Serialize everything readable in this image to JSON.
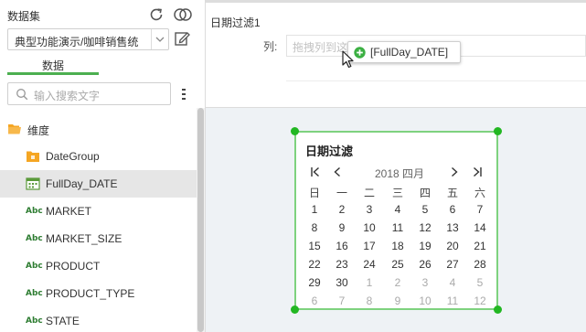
{
  "dataset": {
    "title": "数据集",
    "selected": "典型功能演示/咖啡销售统",
    "tab_label": "数据"
  },
  "search": {
    "placeholder": "输入搜索文字"
  },
  "tree": {
    "group_label": "维度",
    "fields": [
      {
        "label": "DateGroup",
        "type": "folder"
      },
      {
        "label": "FullDay_DATE",
        "type": "date"
      },
      {
        "label": "MARKET",
        "type": "text"
      },
      {
        "label": "MARKET_SIZE",
        "type": "text"
      },
      {
        "label": "PRODUCT",
        "type": "text"
      },
      {
        "label": "PRODUCT_TYPE",
        "type": "text"
      },
      {
        "label": "STATE",
        "type": "text"
      }
    ],
    "text_type_badge": "Abc"
  },
  "component": {
    "title": "日期过滤1",
    "column_label": "列:",
    "drop_placeholder": "拖拽列到这里或添加",
    "drag_chip": "[FullDay_DATE]"
  },
  "calendar": {
    "title": "日期过滤",
    "month_label": "2018 四月",
    "weekdays": [
      "日",
      "一",
      "二",
      "三",
      "四",
      "五",
      "六"
    ],
    "weeks": [
      [
        "1",
        "2",
        "3",
        "4",
        "5",
        "6",
        "7"
      ],
      [
        "8",
        "9",
        "10",
        "11",
        "12",
        "13",
        "14"
      ],
      [
        "15",
        "16",
        "17",
        "18",
        "19",
        "20",
        "21"
      ],
      [
        "22",
        "23",
        "24",
        "25",
        "26",
        "27",
        "28"
      ],
      [
        "29",
        "30",
        "1",
        "2",
        "3",
        "4",
        "5"
      ],
      [
        "6",
        "7",
        "8",
        "9",
        "10",
        "11",
        "12"
      ]
    ],
    "other_month_from_week5_index": 2
  },
  "colors": {
    "accent": "#4caf50",
    "widget_border": "#7ed27e",
    "handle": "#22b722",
    "selected_row": "#e6e6e6"
  }
}
